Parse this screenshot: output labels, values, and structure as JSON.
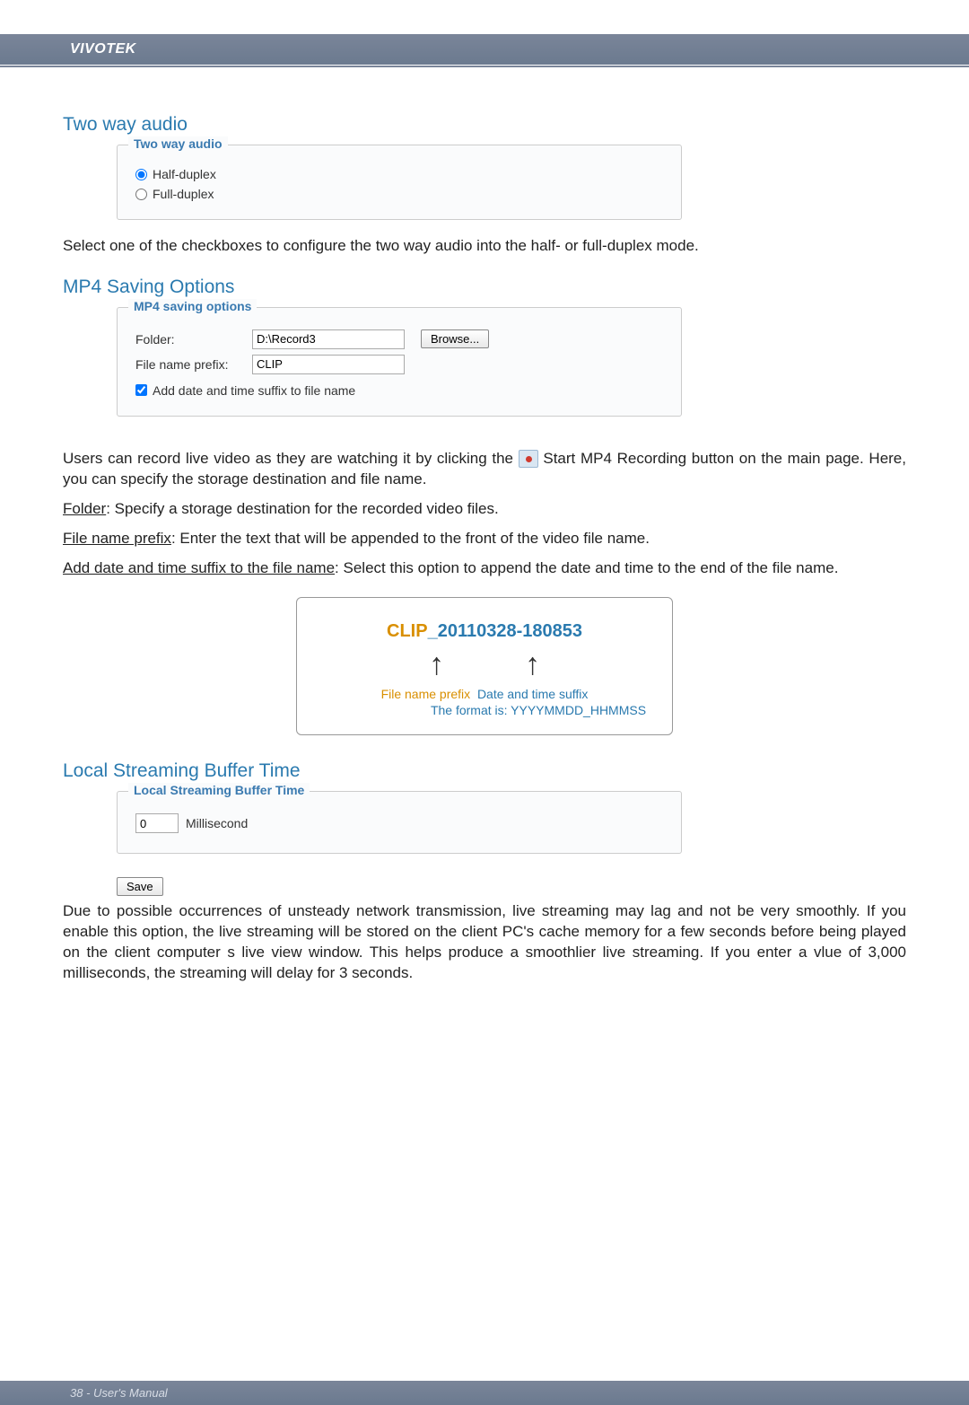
{
  "header": {
    "brand": "VIVOTEK"
  },
  "twoway": {
    "title": "Two way audio",
    "legend": "Two way audio",
    "half": "Half-duplex",
    "full": "Full-duplex",
    "desc": "Select one of the checkboxes to configure the two way audio into the half- or full-duplex mode."
  },
  "mp4": {
    "title": "MP4 Saving Options",
    "legend": "MP4 saving options",
    "folder_label": "Folder:",
    "folder_value": "D:\\Record3",
    "browse": "Browse...",
    "prefix_label": "File name prefix:",
    "prefix_value": "CLIP",
    "suffix_check": "Add date and time suffix to file name",
    "para1a": "Users can record live video as they are watching it by clicking the ",
    "para1b": "  Start MP4 Recording  button on the main page. Here, you can specify the storage destination and file name.",
    "folder_desc_label": "Folder",
    "folder_desc": ": Specify a storage destination for the recorded video files.",
    "prefix_desc_label": "File name prefix",
    "prefix_desc": ": Enter the text that will be appended to the front of the video file name.",
    "suffix_desc_label": "Add date and time suffix to the file name",
    "suffix_desc": ": Select this option to append the date and time to the end of the file name."
  },
  "example": {
    "prefix": "CLIP",
    "sep": "_",
    "suffix": "20110328-180853",
    "label_prefix": "File name prefix",
    "label_suffix": "Date and time suffix",
    "format": "The format is: YYYYMMDD_HHMMSS"
  },
  "buffer": {
    "title": "Local Streaming Buffer Time",
    "legend": "Local Streaming Buffer Time",
    "value": "0",
    "unit": "Millisecond",
    "save": "Save",
    "desc": "Due to possible occurrences of unsteady network transmission, live streaming may lag and not be very smoothly. If you enable this option, the live streaming will be stored on the client PC's cache memory for a few seconds before being played on the client computer s live view window. This helps produce a smoothlier live streaming. If you enter a vlue of 3,000 milliseconds, the streaming will delay for 3 seconds."
  },
  "footer": {
    "text": "38 - User's Manual"
  }
}
